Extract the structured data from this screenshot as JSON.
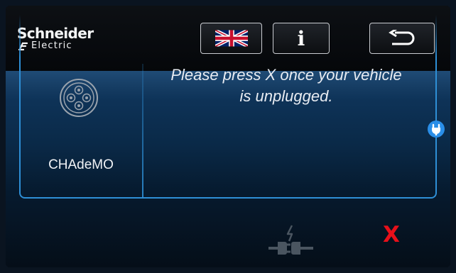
{
  "brand": {
    "name": "Schneider",
    "sub": "Electric"
  },
  "toolbar": {
    "language_icon": "uk-flag-icon",
    "info_label": "i",
    "back_icon": "return-arrow-icon"
  },
  "connector": {
    "label": "CHAdeMO",
    "icon": "chademo-connector-icon"
  },
  "message": {
    "line1": "Please press X once your vehicle",
    "line2": "is unplugged."
  },
  "actions": {
    "close_label": "X"
  },
  "colors": {
    "accent": "#2e8fd6",
    "close": "#e8101a",
    "text": "#e8ecf2",
    "background": "#04070c"
  }
}
